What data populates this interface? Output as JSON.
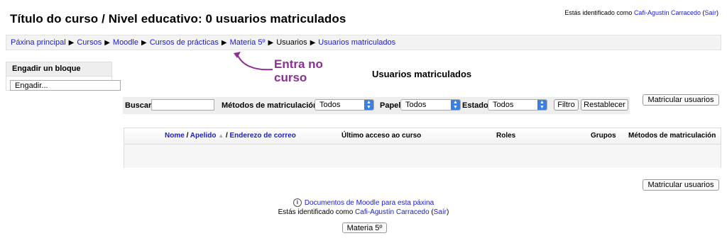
{
  "header": {
    "title": "Título do curso / Nivel educativo: 0 usuarios matriculados",
    "login_prefix": "Estás identificado como",
    "user_name": "Cafi-Agustín Carracedo",
    "logout_label": "Saír"
  },
  "breadcrumb": {
    "items": [
      "Páxina principal",
      "Cursos",
      "Moodle",
      "Cursos de prácticas",
      "Materia 5º",
      "Usuarios",
      "Usuarios matriculados"
    ],
    "separator": "▶"
  },
  "block": {
    "title": "Engadir un bloque",
    "select_value": "Engadir..."
  },
  "annotation": {
    "line1": "Entra no",
    "line2": "curso",
    "color": "#8b2f96"
  },
  "main": {
    "heading": "Usuarios matriculados",
    "enrol_button": "Matricular usuarios"
  },
  "filters": {
    "search_label": "Buscar",
    "search_value": "",
    "methods_label": "Métodos de matriculación",
    "methods_value": "Todos",
    "role_label": "Papel",
    "role_value": "Todos",
    "status_label": "Estado",
    "status_value": "Todos",
    "filter_button": "Filtro",
    "reset_button": "Restablecer"
  },
  "table": {
    "col_name": "Nome",
    "col_slash": "/",
    "col_surname": "Apelido",
    "col_email_sep": "/",
    "col_email": "Enderezo de correo",
    "col_last_access": "Último acceso ao curso",
    "col_roles": "Roles",
    "col_groups": "Grupos",
    "col_methods": "Métodos de matriculación"
  },
  "footer": {
    "docs_link": "Documentos de Moodle para esta páxina",
    "login_prefix": "Estás identificado como",
    "user_name": "Cafi-Agustín Carracedo",
    "logout_label": "Saír",
    "home_button": "Materia 5º"
  },
  "colors": {
    "link": "#1a1ad4",
    "annotation": "#8b2f96",
    "select_arrow": "#3d7fe0"
  }
}
